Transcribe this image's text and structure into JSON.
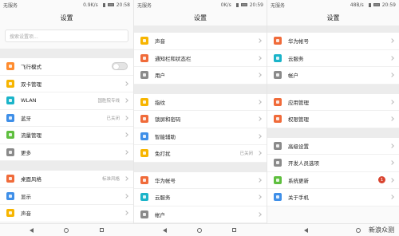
{
  "panels": [
    {
      "status": {
        "carrier": "无服务",
        "speed": "0.9K/s",
        "time": "20:58"
      },
      "title": "设置",
      "search_placeholder": "搜索设置项...",
      "sections": [
        [
          {
            "label": "飞行模式",
            "color": "#ff8c2f",
            "icon": "airplane-icon",
            "control": "toggle",
            "value": ""
          },
          {
            "label": "双卡管理",
            "color": "#f7b500",
            "icon": "sim-card-icon",
            "control": "chevron",
            "value": ""
          },
          {
            "label": "WLAN",
            "color": "#1bb4c9",
            "icon": "wifi-icon",
            "control": "chevron",
            "value": "国胜院专线"
          },
          {
            "label": "蓝牙",
            "color": "#3f8fe8",
            "icon": "bluetooth-icon",
            "control": "chevron",
            "value": "已关闭"
          },
          {
            "label": "流量管理",
            "color": "#5fbf3f",
            "icon": "data-usage-icon",
            "control": "chevron",
            "value": ""
          },
          {
            "label": "更多",
            "color": "#8a8a8a",
            "icon": "more-icon",
            "control": "chevron",
            "value": ""
          }
        ],
        [
          {
            "label": "桌面风格",
            "color": "#f06b3a",
            "icon": "home-style-icon",
            "control": "chevron",
            "value": "标准风格"
          },
          {
            "label": "显示",
            "color": "#3f8fe8",
            "icon": "display-icon",
            "control": "chevron",
            "value": ""
          },
          {
            "label": "声音",
            "color": "#f7b500",
            "icon": "sound-icon",
            "control": "chevron",
            "value": ""
          }
        ]
      ]
    },
    {
      "status": {
        "carrier": "无服务",
        "speed": "0K/s",
        "time": "20:59"
      },
      "title": "设置",
      "search_placeholder": "",
      "sections": [
        [
          {
            "label": "声音",
            "color": "#f7b500",
            "icon": "sound-icon",
            "control": "chevron",
            "value": ""
          },
          {
            "label": "通知栏和状态栏",
            "color": "#f06b3a",
            "icon": "notification-icon",
            "control": "chevron",
            "value": ""
          },
          {
            "label": "用户",
            "color": "#8a8a8a",
            "icon": "user-icon",
            "control": "chevron",
            "value": ""
          }
        ],
        [
          {
            "label": "指纹",
            "color": "#f7b500",
            "icon": "fingerprint-icon",
            "control": "chevron",
            "value": ""
          },
          {
            "label": "锁屏和密码",
            "color": "#f06b3a",
            "icon": "lock-icon",
            "control": "chevron",
            "value": ""
          },
          {
            "label": "智能辅助",
            "color": "#3f8fe8",
            "icon": "assist-icon",
            "control": "chevron",
            "value": ""
          },
          {
            "label": "免打扰",
            "color": "#f7b500",
            "icon": "moon-icon",
            "control": "chevron",
            "value": "已关闭"
          }
        ],
        [
          {
            "label": "华为帐号",
            "color": "#f06b3a",
            "icon": "huawei-account-icon",
            "control": "chevron",
            "value": ""
          },
          {
            "label": "云服务",
            "color": "#1bb4c9",
            "icon": "cloud-icon",
            "control": "chevron",
            "value": ""
          },
          {
            "label": "帐户",
            "color": "#8a8a8a",
            "icon": "account-icon",
            "control": "chevron",
            "value": ""
          }
        ]
      ]
    },
    {
      "status": {
        "carrier": "无服务",
        "speed": "48B/s",
        "time": "20:59"
      },
      "title": "设置",
      "search_placeholder": "",
      "sections": [
        [
          {
            "label": "华为帐号",
            "color": "#f06b3a",
            "icon": "huawei-account-icon",
            "control": "chevron",
            "value": ""
          },
          {
            "label": "云服务",
            "color": "#1bb4c9",
            "icon": "cloud-icon",
            "control": "chevron",
            "value": ""
          },
          {
            "label": "帐户",
            "color": "#8a8a8a",
            "icon": "account-icon",
            "control": "chevron",
            "value": ""
          }
        ],
        [
          {
            "label": "应用管理",
            "color": "#f06b3a",
            "icon": "apps-icon",
            "control": "chevron",
            "value": ""
          },
          {
            "label": "权限管理",
            "color": "#f06b3a",
            "icon": "permission-icon",
            "control": "chevron",
            "value": ""
          }
        ],
        [
          {
            "label": "高级设置",
            "color": "#8a8a8a",
            "icon": "advanced-icon",
            "control": "chevron",
            "value": ""
          },
          {
            "label": "开发人员选项",
            "color": "#8a8a8a",
            "icon": "developer-icon",
            "control": "chevron",
            "value": ""
          },
          {
            "label": "系统更新",
            "color": "#5fbf3f",
            "icon": "update-icon",
            "control": "badge",
            "value": "1"
          },
          {
            "label": "关于手机",
            "color": "#3f8fe8",
            "icon": "about-icon",
            "control": "chevron",
            "value": ""
          }
        ]
      ]
    }
  ],
  "watermark": "新浪众测"
}
